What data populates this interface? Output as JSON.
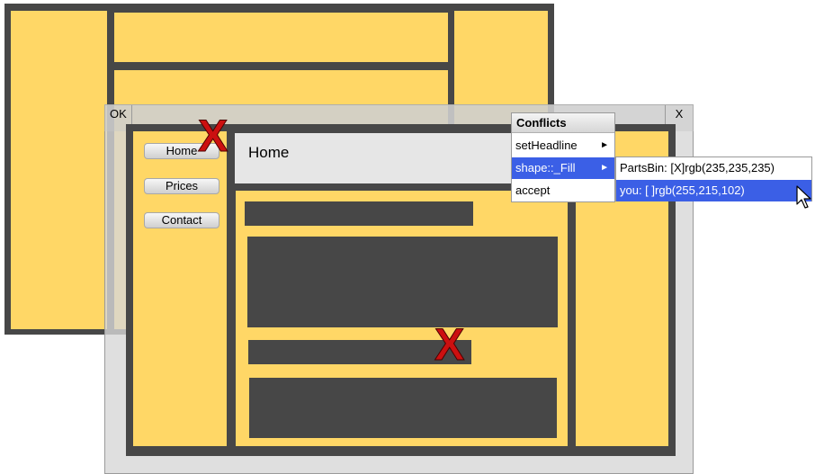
{
  "conflict_window": {
    "ok_label": "OK",
    "close_label": "X"
  },
  "page": {
    "headline": "Home"
  },
  "nav": [
    {
      "label": "Home"
    },
    {
      "label": "Prices"
    },
    {
      "label": "Contact"
    }
  ],
  "marks": {
    "x_glyph": "X",
    "x_color": "#cc1010"
  },
  "conflicts_menu": {
    "title": "Conflicts",
    "items": [
      {
        "label": "setHeadline",
        "arrow": "►"
      },
      {
        "label": "shape::_Fill",
        "arrow": "►"
      },
      {
        "label": "accept"
      }
    ]
  },
  "fill_submenu": {
    "items": [
      {
        "label": "PartsBin: [X]rgb(235,235,235)"
      },
      {
        "label": "you: [ ]rgb(255,215,102)"
      }
    ]
  },
  "colors": {
    "panel_yellow": "#ffd766",
    "frame_dark": "#474747",
    "highlight_blue": "#3b5fe6"
  }
}
